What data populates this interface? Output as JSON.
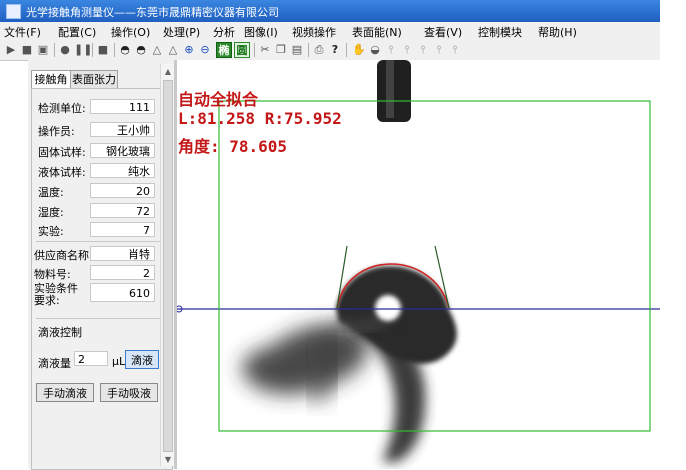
{
  "window": {
    "title": "光学接触角测量仪——东莞市晟鼎精密仪器有限公司"
  },
  "menu": [
    "文件(F)",
    "配置(C)",
    "操作(O)",
    "处理(P)",
    "分析",
    "图像(I)",
    "视频操作",
    "表面能(N)",
    "查看(V)",
    "控制模块",
    "帮助(H)"
  ],
  "toolbar": {
    "fit_ellipse_label": "椭",
    "fit_circle_label": "圆"
  },
  "tabs": [
    "接触角",
    "表面张力"
  ],
  "fields": [
    {
      "label": "检测单位:",
      "value": "111"
    },
    {
      "label": "操作员:",
      "value": "王小帅"
    },
    {
      "label": "固体试样:",
      "value": "钢化玻璃"
    },
    {
      "label": "液体试样:",
      "value": "纯水"
    },
    {
      "label": "温度:",
      "value": "20"
    },
    {
      "label": "湿度:",
      "value": "72"
    },
    {
      "label": "实验:",
      "value": "7"
    }
  ],
  "supplier": {
    "label": "供应商名称",
    "value": "肖特"
  },
  "material": {
    "label": "物料号:",
    "value": "2"
  },
  "condition": {
    "label": "实验条件要求:",
    "value": "610"
  },
  "dispense": {
    "section_title": "滴液控制",
    "volume_label": "滴液量",
    "volume_value": "2",
    "unit": "μL",
    "dispense_button": "滴液",
    "manual_dispense": "手动滴液",
    "manual_aspirate": "手动吸液"
  },
  "overlay": {
    "mode": "自动全拟合",
    "lr": "L:81.258  R:75.952",
    "angle": "角度: 78.605"
  },
  "colors": {
    "overlay_text": "#c41818",
    "roi_box": "#33bb33",
    "baseline": "#2a2a9a",
    "fit_curve": "#cc2222",
    "title_bar": "#2c6fd0"
  }
}
